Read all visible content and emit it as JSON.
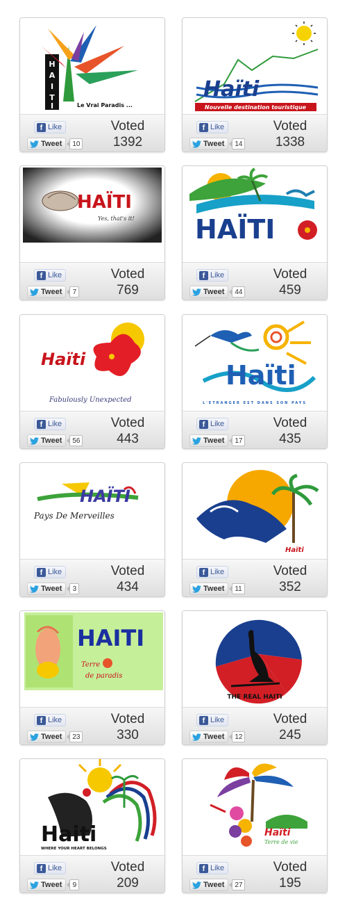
{
  "buttons": {
    "like_label": "Like",
    "tweet_label": "Tweet",
    "voted_label": "Voted"
  },
  "cards": [
    {
      "logo_text": "HAITI",
      "tagline": "Le Vrai Paradis ...",
      "tweets": "10",
      "votes": "1392"
    },
    {
      "logo_text": "Haïti",
      "tagline": "Nouvelle destination touristique",
      "tweets": "14",
      "votes": "1338"
    },
    {
      "logo_text": "HAÏTI",
      "tagline": "Yes, that's it!",
      "tweets": "7",
      "votes": "769"
    },
    {
      "logo_text": "HAÏTI",
      "tagline": "",
      "tweets": "44",
      "votes": "459"
    },
    {
      "logo_text": "Haïti",
      "tagline": "Fabulously Unexpected",
      "tweets": "56",
      "votes": "443"
    },
    {
      "logo_text": "Haïti",
      "tagline": "L'ETRANGER EST DANS SON PAYS",
      "tweets": "17",
      "votes": "435"
    },
    {
      "logo_text": "HAITI",
      "tagline": "Pays De Merveilles",
      "tweets": "3",
      "votes": "434"
    },
    {
      "logo_text": "HAITI",
      "tagline": "Haïti",
      "tweets": "11",
      "votes": "352"
    },
    {
      "logo_text": "HAITI",
      "tagline": "Terre de paradis",
      "tweets": "23",
      "votes": "330"
    },
    {
      "logo_text": "THE REAL HAITI",
      "tagline": "",
      "tweets": "12",
      "votes": "245"
    },
    {
      "logo_text": "Haiti",
      "tagline": "WHERE YOUR HEART BELONGS",
      "tweets": "9",
      "votes": "209"
    },
    {
      "logo_text": "Haïti",
      "tagline": "Terre de vie",
      "tweets": "27",
      "votes": "195"
    }
  ],
  "colors": {
    "facebook_blue": "#3b5998",
    "twitter_blue": "#2ba2e0",
    "haiti_blue": "#1a3f8f",
    "haiti_red": "#d21f26"
  }
}
